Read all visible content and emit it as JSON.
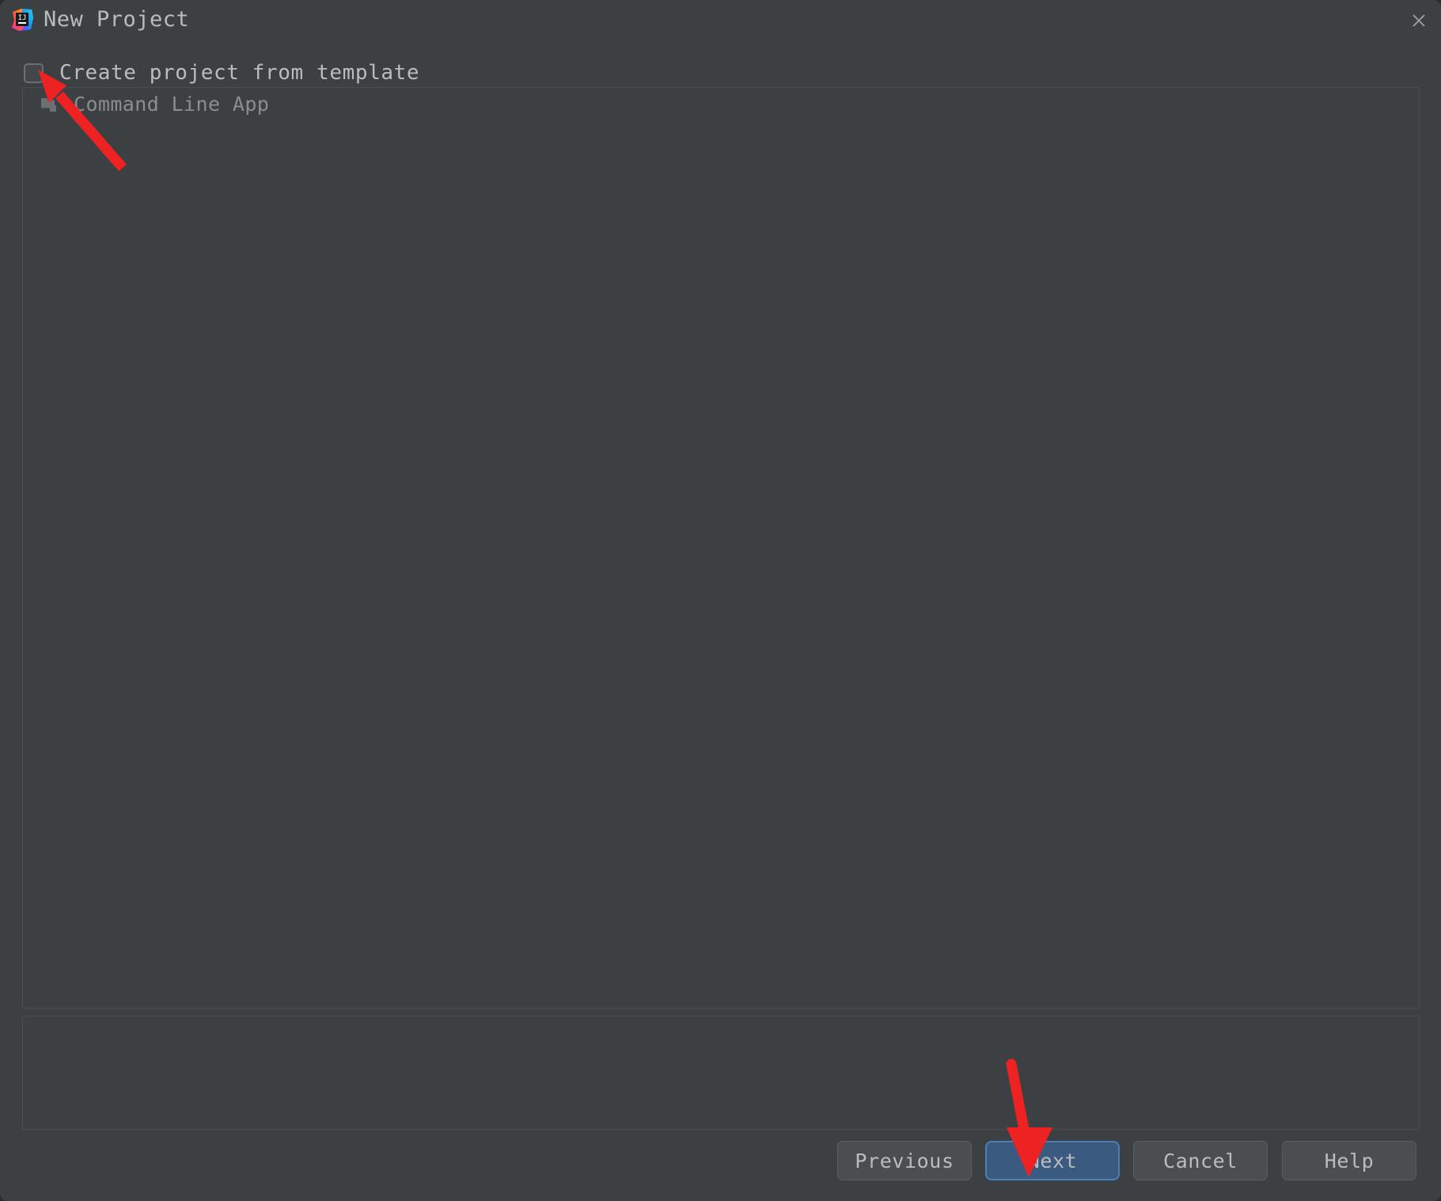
{
  "window": {
    "title": "New Project",
    "app_icon": "intellij-idea-icon",
    "close_icon": "close-icon",
    "background_color": "#3c4042",
    "text_color": "#b9bdbe"
  },
  "template_option": {
    "label": "Create project from template",
    "checked": false
  },
  "template_list": {
    "items": [
      {
        "label": "Command Line App",
        "icon": "folder-icon",
        "selected": false,
        "disabled": true
      }
    ]
  },
  "settings_panel": {
    "content": ""
  },
  "buttons": {
    "previous": "Previous",
    "next": "Next",
    "cancel": "Cancel",
    "help": "Help",
    "default_button": "Next",
    "default_button_color": "#3a5a80",
    "default_button_border_color": "#4d7db5"
  },
  "annotations": {
    "arrow_color": "#ee2222",
    "arrows": [
      {
        "name": "arrow-to-checkbox",
        "points_to": "create-project-from-template-checkbox"
      },
      {
        "name": "arrow-to-next-button",
        "points_to": "next-button"
      }
    ]
  }
}
